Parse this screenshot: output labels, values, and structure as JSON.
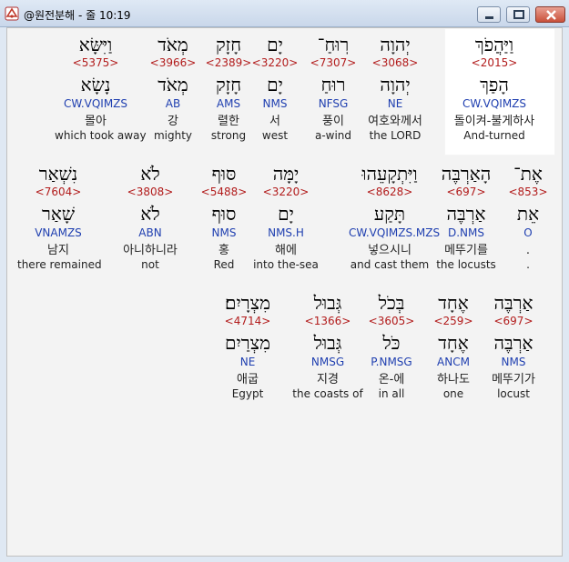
{
  "window": {
    "title": "@원전분해 - 줄 10:19"
  },
  "rows": [
    [
      {
        "heb": "וַיַּהֲפֹךְ",
        "num": "<2015>",
        "lemma": "הָפַךְ",
        "parse": "CW.VQIMZS",
        "kor": "돌이켜-불게하사",
        "eng": "And-turned",
        "selected": true
      },
      {
        "heb": "יְהוָה",
        "num": "<3068>",
        "lemma": "יְהוָה",
        "parse": "NE",
        "kor": "여호와께서",
        "eng": "the LORD"
      },
      {
        "heb": "רֽוּחַ־",
        "num": "<7307>",
        "lemma": "רוּחַ",
        "parse": "NFSG",
        "kor": "풍이",
        "eng": "a-wind"
      },
      {
        "heb": "יָם",
        "num": "<3220>",
        "lemma": "יָם",
        "parse": "NMS",
        "kor": "서",
        "eng": "west"
      },
      {
        "heb": "חָזָק",
        "num": "<2389>",
        "lemma": "חָזָק",
        "parse": "AMS",
        "kor": "렬한",
        "eng": "strong"
      },
      {
        "heb": "מְאֹד",
        "num": "<3966>",
        "lemma": "מְאֹד",
        "parse": "AB",
        "kor": "강",
        "eng": "mighty"
      },
      {
        "heb": "וַיִּשָּׂא",
        "num": "<5375>",
        "lemma": "נָשָׂא",
        "parse": "CW.VQIMZS",
        "kor": "몰아",
        "eng": "which took away"
      }
    ],
    [
      {
        "heb": "אֶת־",
        "num": "<853>",
        "lemma": "אֵת",
        "parse": "O",
        "kor": ".",
        "eng": "."
      },
      {
        "heb": "הָאַרְבֶּה",
        "num": "<697>",
        "lemma": "אַרְבֶּה",
        "parse": "D.NMS",
        "kor": "메뚜기를",
        "eng": "the locusts"
      },
      {
        "heb": "וַיִּתְקָעֵהוּ",
        "num": "<8628>",
        "lemma": "תָּקַע",
        "parse": "CW.VQIMZS.MZS",
        "kor": "넣으시니",
        "eng": "and cast them"
      },
      {
        "heb": "יָמָּה",
        "num": "<3220>",
        "lemma": "יָם",
        "parse": "NMS.H",
        "kor": "해에",
        "eng": "into the-sea"
      },
      {
        "heb": "סּוּף",
        "num": "<5488>",
        "lemma": "סוּף",
        "parse": "NMS",
        "kor": "홍",
        "eng": "Red"
      },
      {
        "heb": "לֹא",
        "num": "<3808>",
        "lemma": "לֹא",
        "parse": "ABN",
        "kor": "아니하니라",
        "eng": "not"
      },
      {
        "heb": "נִשְׁאַר",
        "num": "<7604>",
        "lemma": "שָׁאַר",
        "parse": "VNAMZS",
        "kor": "남지",
        "eng": "there remained"
      }
    ],
    [
      {
        "heb": "אַרְבֶּה",
        "num": "<697>",
        "lemma": "אַרְבֶּה",
        "parse": "NMS",
        "kor": "메뚜기가",
        "eng": "locust"
      },
      {
        "heb": "אֶחָד",
        "num": "<259>",
        "lemma": "אֶחָד",
        "parse": "ANCM",
        "kor": "하나도",
        "eng": "one"
      },
      {
        "heb": "בְּכֹל",
        "num": "<3605>",
        "lemma": "כֹּל",
        "parse": "P.NMSG",
        "kor": "온-에",
        "eng": "in all"
      },
      {
        "heb": "גְּבוּל",
        "num": "<1366>",
        "lemma": "גְּבוּל",
        "parse": "NMSG",
        "kor": "지경",
        "eng": "the coasts of"
      },
      {
        "heb": "מִצְרָיִם׃",
        "num": "<4714>",
        "lemma": "מִצְרַיִם",
        "parse": "NE",
        "kor": "애굽",
        "eng": "Egypt"
      }
    ]
  ]
}
